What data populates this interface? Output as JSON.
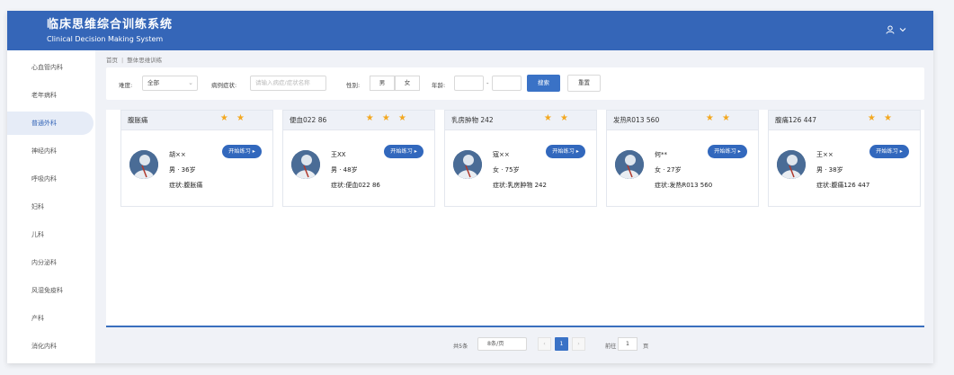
{
  "header": {
    "title": "临床思维综合训练系统",
    "subtitle": "Clinical Decision Making System",
    "user_icon": "user-icon"
  },
  "sidebar": {
    "items": [
      {
        "label": "心血管内科"
      },
      {
        "label": "老年病科"
      },
      {
        "label": "普通外科",
        "active": true
      },
      {
        "label": "神经内科"
      },
      {
        "label": "呼吸内科"
      },
      {
        "label": "妇科"
      },
      {
        "label": "儿科"
      },
      {
        "label": "内分泌科"
      },
      {
        "label": "风湿免疫科"
      },
      {
        "label": "产科"
      },
      {
        "label": "消化内科"
      }
    ]
  },
  "breadcrumb": {
    "home": "首页",
    "current": "整体思维训练"
  },
  "filters": {
    "difficulty_label": "难度:",
    "difficulty_value": "全部",
    "case_label": "病例症状:",
    "case_placeholder": "请输入病症/症状名称",
    "gender_label": "性别:",
    "gender_male": "男",
    "gender_female": "女",
    "age_label": "年龄:",
    "age_from": "",
    "age_to": "",
    "age_sep": "-",
    "search_label": "搜索",
    "reset_label": "重置"
  },
  "cards": [
    {
      "title": "腹胀痛",
      "stars": "★ ★",
      "name": "胡××",
      "info": "男 · 36岁",
      "symptom": "症状:腹胀痛",
      "button": "开始练习 ▸"
    },
    {
      "title": "便血022 86",
      "stars": "★ ★ ★",
      "name": "王XX",
      "info": "男 · 48岁",
      "symptom": "症状:便血022 86",
      "button": "开始练习 ▸"
    },
    {
      "title": "乳房肿物 242",
      "stars": "★ ★",
      "name": "寇××",
      "info": "女 · 75岁",
      "symptom": "症状:乳房肿物 242",
      "button": "开始练习 ▸"
    },
    {
      "title": "发热R013 560",
      "stars": "★ ★",
      "name": "何**",
      "info": "女 · 27岁",
      "symptom": "症状:发热R013 560",
      "button": "开始练习 ▸"
    },
    {
      "title": "腹痛126 447",
      "stars": "★ ★",
      "name": "王××",
      "info": "男 · 38岁",
      "symptom": "症状:腹痛126 447",
      "button": "开始练习 ▸"
    }
  ],
  "pagination": {
    "total": "共5条",
    "page_size": "8条/页",
    "prev": "‹",
    "current_page": "1",
    "next": "›",
    "goto_label": "前往",
    "goto_value": "1",
    "goto_suffix": "页"
  },
  "colors": {
    "header": "#3566b8",
    "accent": "#3a72c6",
    "star": "#f3a820"
  }
}
